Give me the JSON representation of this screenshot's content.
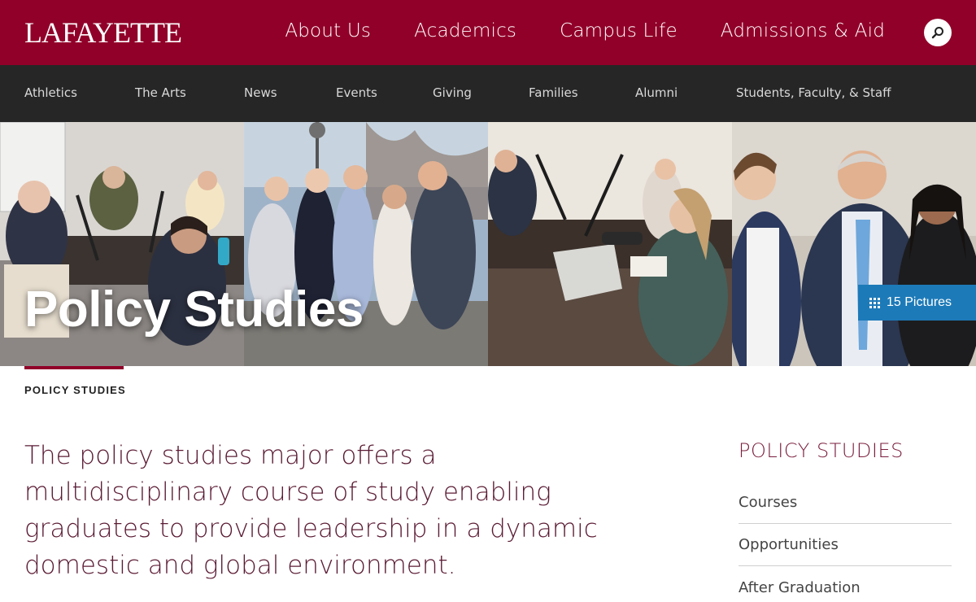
{
  "header": {
    "logo": "LAFAYETTE",
    "primary_nav": [
      "About Us",
      "Academics",
      "Campus Life",
      "Admissions & Aid"
    ]
  },
  "secondary_nav": [
    "Athletics",
    "The Arts",
    "News",
    "Events",
    "Giving",
    "Families",
    "Alumni",
    "Students, Faculty, & Staff"
  ],
  "hero": {
    "title": "Policy Studies",
    "gallery_label": "15 Pictures"
  },
  "breadcrumb": "POLICY STUDIES",
  "intro": "The policy studies major offers a multidisciplinary course of study enabling graduates to provide leadership in a dynamic domestic and global environment.",
  "sidebar": {
    "title": "POLICY STUDIES",
    "items": [
      "Courses",
      "Opportunities",
      "After Graduation"
    ]
  },
  "colors": {
    "brand": "#910029",
    "subnav_bg": "#262626",
    "gallery_button": "#1d7ab8",
    "intro_text": "#5a1a33"
  }
}
